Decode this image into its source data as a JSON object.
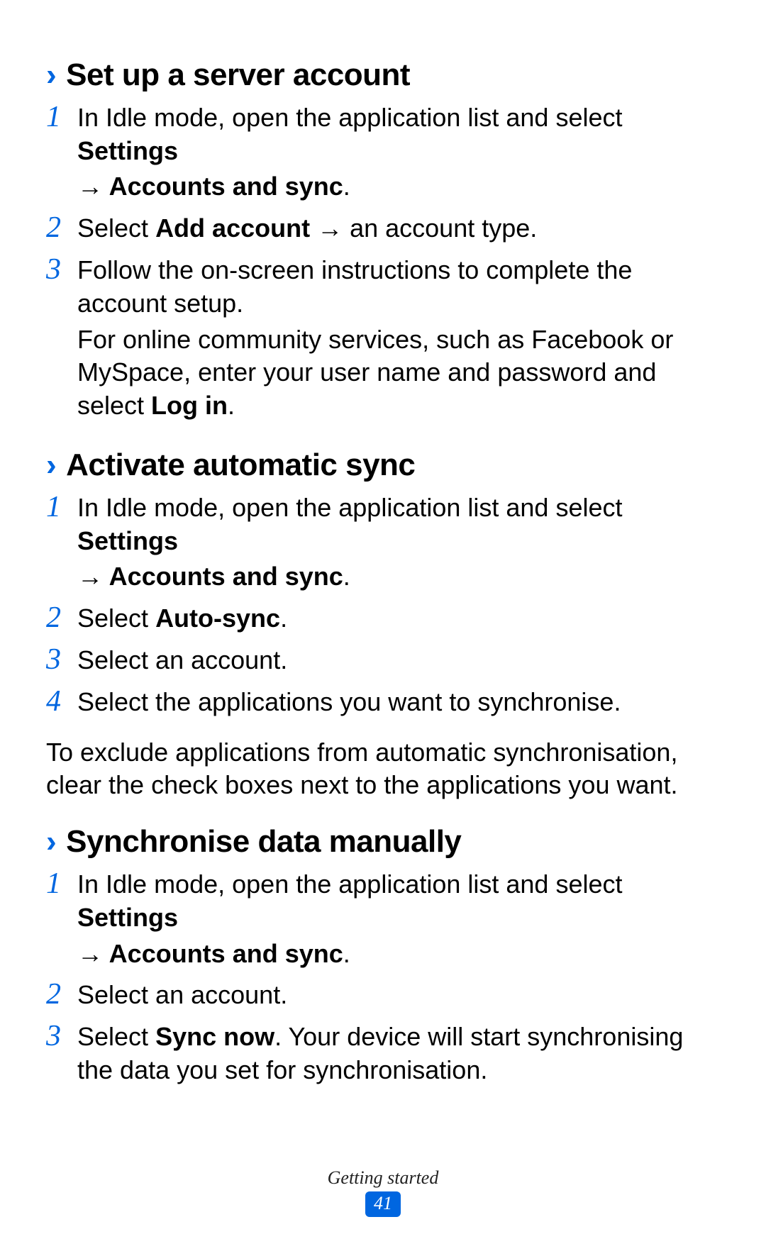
{
  "sections": [
    {
      "heading": "Set up a server account",
      "steps": [
        {
          "num": "1",
          "lines": [
            {
              "segments": [
                {
                  "text": "In Idle mode, open the application list and select "
                },
                {
                  "text": "Settings",
                  "bold": true
                }
              ]
            },
            {
              "segments": [
                {
                  "text": "→ ",
                  "bold": true
                },
                {
                  "text": "Accounts and sync",
                  "bold": true
                },
                {
                  "text": "."
                }
              ]
            }
          ]
        },
        {
          "num": "2",
          "lines": [
            {
              "segments": [
                {
                  "text": "Select "
                },
                {
                  "text": "Add account",
                  "bold": true
                },
                {
                  "text": " → an account type."
                }
              ]
            }
          ]
        },
        {
          "num": "3",
          "lines": [
            {
              "segments": [
                {
                  "text": "Follow the on-screen instructions to complete the account setup."
                }
              ]
            },
            {
              "segments": [
                {
                  "text": "For online community services, such as Facebook or MySpace, enter your user name and password and select "
                },
                {
                  "text": "Log in",
                  "bold": true
                },
                {
                  "text": "."
                }
              ]
            }
          ]
        }
      ]
    },
    {
      "heading": "Activate automatic sync",
      "steps": [
        {
          "num": "1",
          "lines": [
            {
              "segments": [
                {
                  "text": "In Idle mode, open the application list and select "
                },
                {
                  "text": "Settings",
                  "bold": true
                }
              ]
            },
            {
              "segments": [
                {
                  "text": "→ ",
                  "bold": true
                },
                {
                  "text": "Accounts and sync",
                  "bold": true
                },
                {
                  "text": "."
                }
              ]
            }
          ]
        },
        {
          "num": "2",
          "lines": [
            {
              "segments": [
                {
                  "text": "Select "
                },
                {
                  "text": "Auto-sync",
                  "bold": true
                },
                {
                  "text": "."
                }
              ]
            }
          ]
        },
        {
          "num": "3",
          "lines": [
            {
              "segments": [
                {
                  "text": "Select an account."
                }
              ]
            }
          ]
        },
        {
          "num": "4",
          "lines": [
            {
              "segments": [
                {
                  "text": "Select the applications you want to synchronise."
                }
              ]
            }
          ]
        }
      ],
      "trailing": "To exclude applications from automatic synchronisation, clear the check boxes next to the applications you want."
    },
    {
      "heading": "Synchronise data manually",
      "steps": [
        {
          "num": "1",
          "lines": [
            {
              "segments": [
                {
                  "text": "In Idle mode, open the application list and select "
                },
                {
                  "text": "Settings",
                  "bold": true
                }
              ]
            },
            {
              "segments": [
                {
                  "text": "→ ",
                  "bold": true
                },
                {
                  "text": "Accounts and sync",
                  "bold": true
                },
                {
                  "text": "."
                }
              ]
            }
          ]
        },
        {
          "num": "2",
          "lines": [
            {
              "segments": [
                {
                  "text": "Select an account."
                }
              ]
            }
          ]
        },
        {
          "num": "3",
          "lines": [
            {
              "segments": [
                {
                  "text": "Select "
                },
                {
                  "text": "Sync now",
                  "bold": true
                },
                {
                  "text": ". Your device will start synchronising the data you set for synchronisation."
                }
              ]
            }
          ]
        }
      ]
    }
  ],
  "footer": {
    "label": "Getting started",
    "page": "41"
  },
  "chevron": "›"
}
